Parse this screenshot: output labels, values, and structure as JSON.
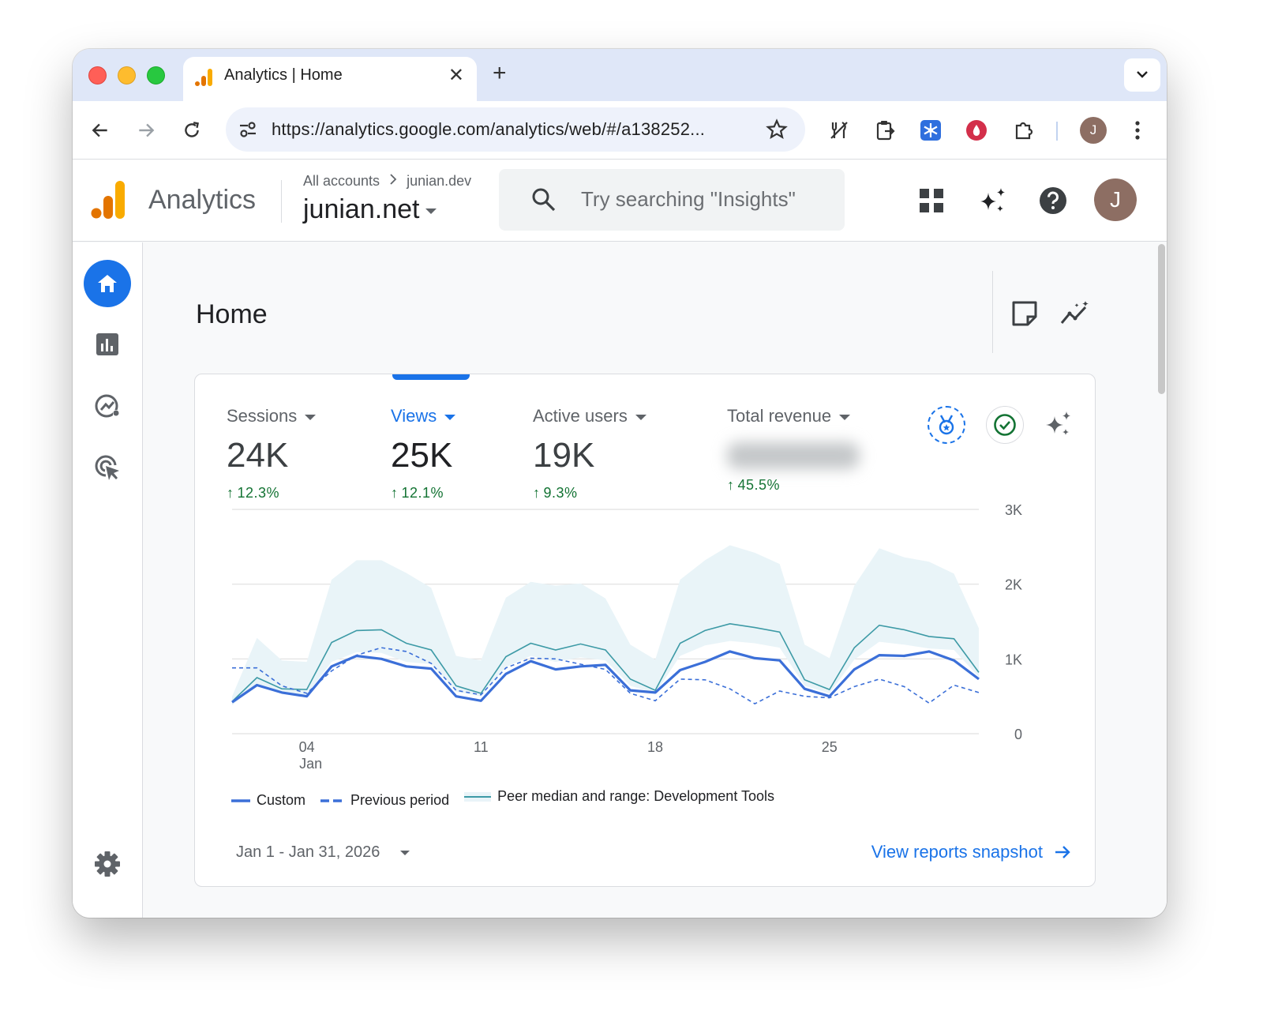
{
  "browser": {
    "tab_title": "Analytics | Home",
    "url": "https://analytics.google.com/analytics/web/#/a138252...",
    "profile_initial": "J"
  },
  "header": {
    "product_name": "Analytics",
    "breadcrumb_root": "All accounts",
    "breadcrumb_account": "junian.dev",
    "property_name": "junian.net",
    "search_placeholder": "Try searching \"Insights\"",
    "profile_initial": "J"
  },
  "page": {
    "title": "Home"
  },
  "metrics": [
    {
      "label": "Sessions",
      "value": "24K",
      "change": "12.3%",
      "active": false
    },
    {
      "label": "Views",
      "value": "25K",
      "change": "12.1%",
      "active": true
    },
    {
      "label": "Active users",
      "value": "19K",
      "change": "9.3%",
      "active": false
    },
    {
      "label": "Total revenue",
      "value": "",
      "change": "45.5%",
      "active": false
    }
  ],
  "colors": {
    "primary_blue": "#1a73e8",
    "custom_line": "#3b6fd8",
    "previous_line": "#3b6fd8",
    "peer_median": "#3d9aa6",
    "peer_range": "#e9f4f8",
    "positive_change": "#137333"
  },
  "chart_data": {
    "type": "line",
    "x_labels": [
      "04\nJan",
      "11",
      "18",
      "25"
    ],
    "x_tick_days": [
      4,
      11,
      18,
      25
    ],
    "days": [
      1,
      2,
      3,
      4,
      5,
      6,
      7,
      8,
      9,
      10,
      11,
      12,
      13,
      14,
      15,
      16,
      17,
      18,
      19,
      20,
      21,
      22,
      23,
      24,
      25,
      26,
      27,
      28,
      29,
      30,
      31
    ],
    "ylim": [
      0,
      3000
    ],
    "y_ticks": [
      "0",
      "1K",
      "2K",
      "3K"
    ],
    "series": [
      {
        "name": "Custom",
        "style": "solid",
        "values": [
          420,
          650,
          550,
          500,
          900,
          1040,
          1000,
          900,
          870,
          500,
          440,
          800,
          970,
          860,
          900,
          920,
          580,
          550,
          850,
          960,
          1100,
          1010,
          980,
          600,
          500,
          860,
          1050,
          1040,
          1100,
          980,
          730
        ]
      },
      {
        "name": "Previous period",
        "style": "dashed",
        "values": [
          880,
          880,
          640,
          540,
          840,
          1050,
          1150,
          1100,
          940,
          580,
          520,
          880,
          1010,
          1000,
          930,
          860,
          540,
          440,
          730,
          720,
          600,
          400,
          570,
          500,
          480,
          630,
          730,
          630,
          410,
          650,
          550
        ]
      },
      {
        "name": "Peer median and range: Development Tools",
        "style": "band",
        "values": [
          430,
          750,
          600,
          590,
          1220,
          1380,
          1390,
          1210,
          1120,
          640,
          540,
          1030,
          1210,
          1120,
          1200,
          1120,
          730,
          580,
          1210,
          1380,
          1470,
          1420,
          1360,
          720,
          590,
          1150,
          1450,
          1390,
          1300,
          1270,
          820
        ],
        "range_low": [
          380,
          660,
          540,
          520,
          960,
          1090,
          1080,
          960,
          930,
          560,
          500,
          890,
          1040,
          960,
          1020,
          980,
          640,
          540,
          1040,
          1180,
          1240,
          1210,
          1150,
          640,
          540,
          990,
          1230,
          1190,
          1140,
          1120,
          760
        ],
        "range_high": [
          500,
          1280,
          980,
          960,
          2060,
          2320,
          2320,
          2150,
          1950,
          1040,
          980,
          1820,
          2030,
          1980,
          2010,
          1810,
          1190,
          990,
          2060,
          2320,
          2520,
          2420,
          2270,
          1190,
          1010,
          1980,
          2480,
          2360,
          2300,
          2140,
          1410
        ]
      }
    ]
  },
  "legend": {
    "custom": "Custom",
    "previous": "Previous period",
    "peer": "Peer median and range: Development Tools"
  },
  "footer": {
    "date_range": "Jan 1 - Jan 31, 2026",
    "snapshot_link": "View reports snapshot"
  }
}
